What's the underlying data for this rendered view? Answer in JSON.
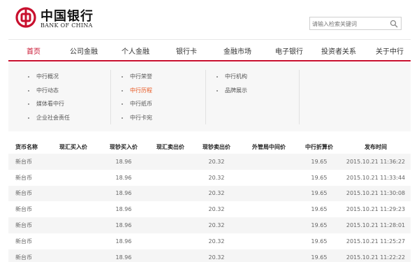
{
  "brand": {
    "name_cn": "中国银行",
    "name_en": "BANK OF CHINA",
    "accent": "#c8102e"
  },
  "search": {
    "placeholder": "请输入检索关键词",
    "icon": "search-icon"
  },
  "nav": {
    "items": [
      "首页",
      "公司金融",
      "个人金融",
      "银行卡",
      "金融市场",
      "电子银行",
      "投资者关系",
      "关于中行"
    ],
    "active": "首页"
  },
  "dropdown": {
    "col1": [
      "中行概况",
      "中行动态",
      "媒体看中行",
      "企业社会责任"
    ],
    "col2": [
      "中行荣誉",
      "中行历程",
      "中行纸币",
      "中行卡宛"
    ],
    "col3": [
      "中行机构",
      "品牌展示"
    ],
    "highlight": "中行历程",
    "highlight_color": "#e8551e"
  },
  "table": {
    "headers": [
      "货币名称",
      "现汇买入价",
      "现钞买入价",
      "现汇卖出价",
      "现钞卖出价",
      "外管局中间价",
      "中行折算价",
      "发布时间"
    ],
    "rows": [
      [
        "新台币",
        "",
        "18.96",
        "",
        "20.32",
        "",
        "19.65",
        "2015.10.21 11:36:22"
      ],
      [
        "新台币",
        "",
        "18.96",
        "",
        "20.32",
        "",
        "19.65",
        "2015.10.21 11:33:44"
      ],
      [
        "新台币",
        "",
        "18.96",
        "",
        "20.32",
        "",
        "19.65",
        "2015.10.21 11:30:08"
      ],
      [
        "新台币",
        "",
        "18.96",
        "",
        "20.32",
        "",
        "19.65",
        "2015.10.21 11:29:23"
      ],
      [
        "新台币",
        "",
        "18.96",
        "",
        "20.32",
        "",
        "19.65",
        "2015.10.21 11:28:01"
      ],
      [
        "新台币",
        "",
        "18.96",
        "",
        "20.32",
        "",
        "19.65",
        "2015.10.21 11:25:27"
      ],
      [
        "新台币",
        "",
        "18.96",
        "",
        "20.32",
        "",
        "19.65",
        "2015.10.21 11:22:22"
      ]
    ]
  }
}
